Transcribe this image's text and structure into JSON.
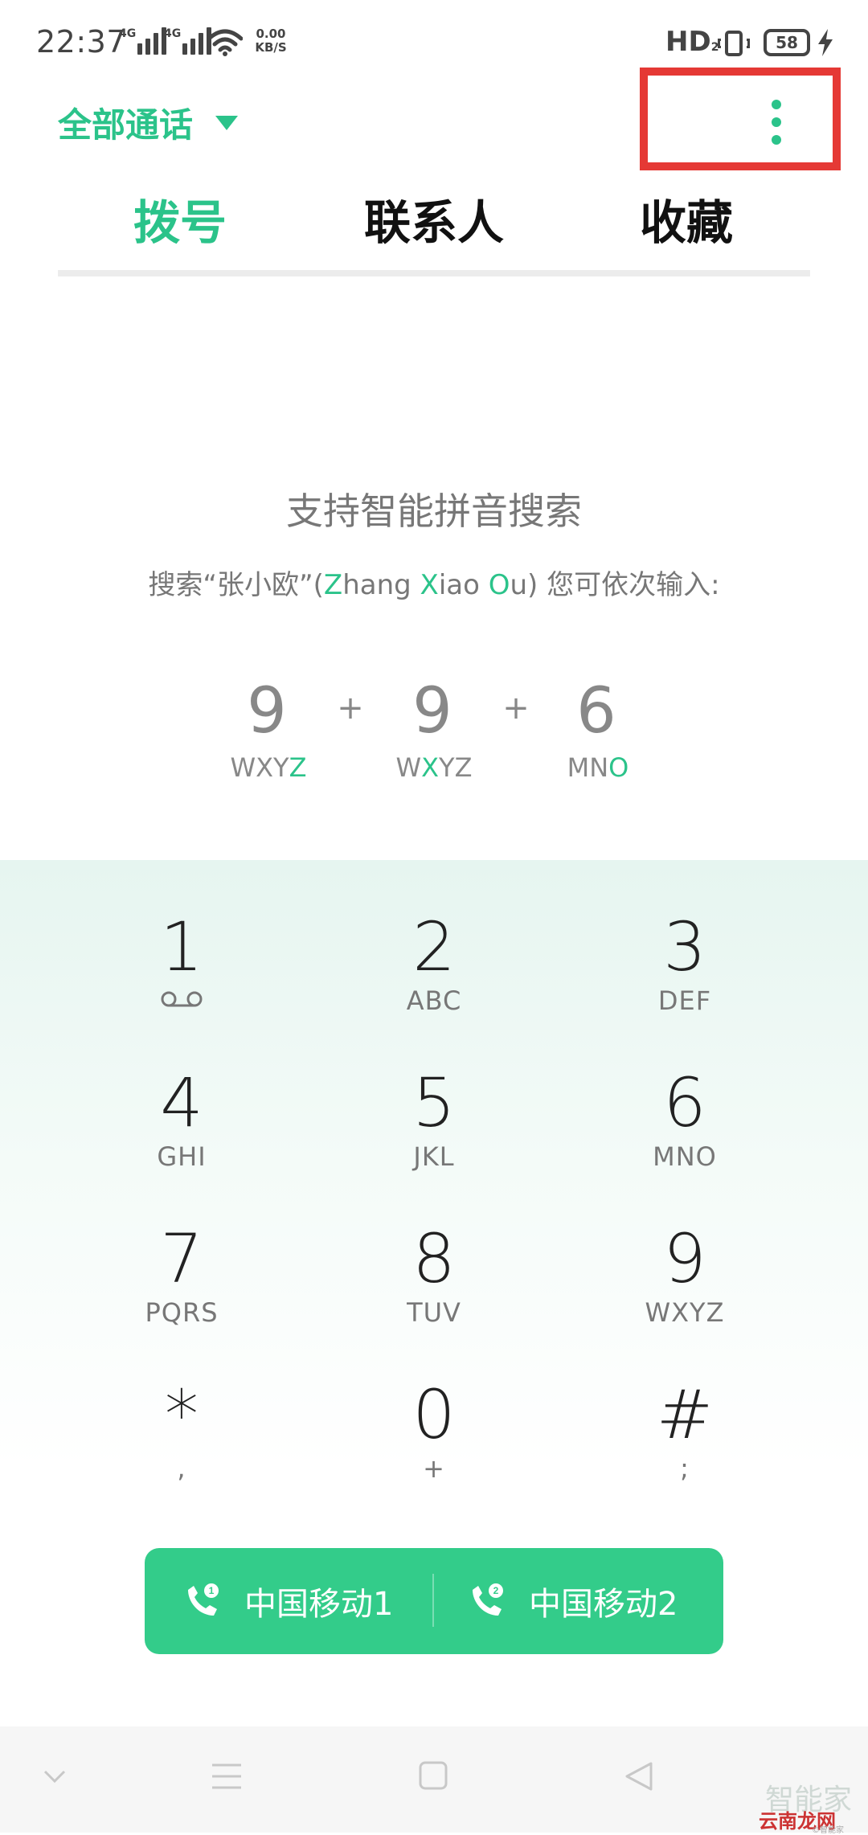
{
  "status_bar": {
    "time": "22:37",
    "signal1_label": "4G",
    "signal2_label": "4G",
    "speed_value": "0.00",
    "speed_unit": "KB/S",
    "hd": "HD",
    "hd_sub": "2",
    "battery": "58"
  },
  "header": {
    "filter_label": "全部通话"
  },
  "tabs": [
    {
      "label": "拨号",
      "active": true
    },
    {
      "label": "联系人",
      "active": false
    },
    {
      "label": "收藏",
      "active": false
    }
  ],
  "hint": {
    "title": "支持智能拼音搜索",
    "desc_prefix": "搜索“张小欧”(",
    "z1": "Z",
    "p1": "hang ",
    "x1": "X",
    "p2": "iao ",
    "o1": "O",
    "p3": "u) 您可依次输入:",
    "digits": [
      "9",
      "9",
      "6"
    ],
    "plus": "+",
    "letters": [
      {
        "pre": "WXY",
        "hl": "Z",
        "post": ""
      },
      {
        "pre": "W",
        "hl": "X",
        "post": "YZ"
      },
      {
        "pre": "MN",
        "hl": "O",
        "post": ""
      }
    ]
  },
  "keypad": [
    {
      "digit": "1",
      "sub": ""
    },
    {
      "digit": "2",
      "sub": "ABC"
    },
    {
      "digit": "3",
      "sub": "DEF"
    },
    {
      "digit": "4",
      "sub": "GHI"
    },
    {
      "digit": "5",
      "sub": "JKL"
    },
    {
      "digit": "6",
      "sub": "MNO"
    },
    {
      "digit": "7",
      "sub": "PQRS"
    },
    {
      "digit": "8",
      "sub": "TUV"
    },
    {
      "digit": "9",
      "sub": "WXYZ"
    },
    {
      "digit": "*",
      "sub": ","
    },
    {
      "digit": "0",
      "sub": "+"
    },
    {
      "digit": "#",
      "sub": ";"
    }
  ],
  "call_buttons": [
    {
      "label": "中国移动1",
      "sim": "1"
    },
    {
      "label": "中国移动2",
      "sim": "2"
    }
  ],
  "watermark": {
    "line1": "智能家",
    "line2": "云南龙网",
    "line3": "©智能家"
  },
  "colors": {
    "accent": "#2bc38a",
    "call_bar": "#33cc8a",
    "highlight": "#e53935"
  },
  "icons": {
    "voicemail": "voicemail-icon",
    "phone_sim": "phone-sim-icon",
    "more": "more-vertical-icon",
    "dropdown": "dropdown-triangle-icon"
  }
}
